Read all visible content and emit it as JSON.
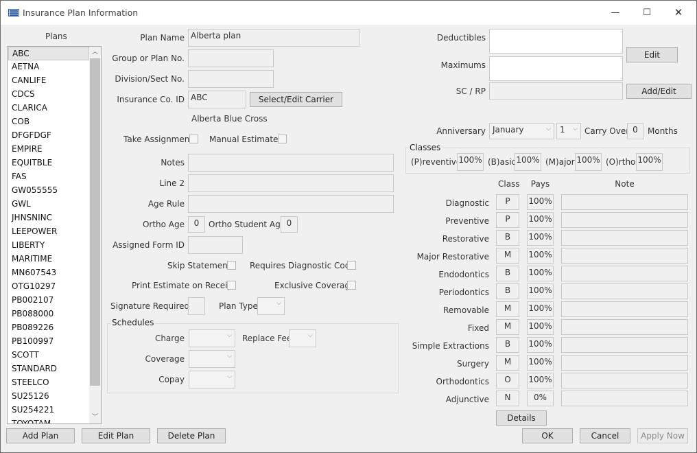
{
  "window": {
    "title": "Insurance Plan Information",
    "minimize": "—",
    "maximize": "☐",
    "close": "✕"
  },
  "plans": {
    "header": "Plans",
    "items": [
      "ABC",
      "AETNA",
      "CANLIFE",
      "CDCS",
      "CLARICA",
      "COB",
      "DFGFDGF",
      "EMPIRE",
      "EQUITBLE",
      "FAS",
      "GW055555",
      "GWL",
      "JHNSNINC",
      "LEEPOWER",
      "LIBERTY",
      "MARITIME",
      "MN607543",
      "OTG10297",
      "PB002107",
      "PB088000",
      "PB089226",
      "PB100997",
      "SCOTT",
      "STANDARD",
      "STEELCO",
      "SU25126",
      "SU254221",
      "TOYOTAM"
    ],
    "selected": "ABC"
  },
  "form": {
    "plan_name_label": "Plan Name",
    "plan_name": "Alberta plan",
    "group_label": "Group or Plan No.",
    "group": "",
    "division_label": "Division/Sect No.",
    "division": "",
    "ins_co_label": "Insurance Co. ID",
    "ins_co": "ABC",
    "select_carrier": "Select/Edit Carrier",
    "carrier_name": "Alberta Blue Cross",
    "take_assignment": "Take Assignment",
    "manual_estimates": "Manual Estimates",
    "notes_label": "Notes",
    "line2_label": "Line 2",
    "age_rule_label": "Age Rule",
    "ortho_age_label": "Ortho Age",
    "ortho_age": "0",
    "ortho_student_age_label": "Ortho Student Age",
    "ortho_student_age": "0",
    "assigned_form_label": "Assigned Form ID",
    "skip_statement": "Skip Statement",
    "requires_diag": "Requires Diagnostic Code",
    "print_estimate": "Print Estimate on Receipt",
    "exclusive_coverage": "Exclusive Coverage",
    "signature_label": "Signature Required",
    "plan_type_label": "Plan Type"
  },
  "schedules": {
    "title": "Schedules",
    "charge_label": "Charge",
    "replace_fee_label": "Replace Fee",
    "coverage_label": "Coverage",
    "copay_label": "Copay"
  },
  "right": {
    "deductibles_label": "Deductibles",
    "maximums_label": "Maximums",
    "edit_button": "Edit",
    "scrp_label": "SC / RP",
    "addedit_button": "Add/Edit",
    "anniversary_label": "Anniversary",
    "anniversary_month": "January",
    "anniversary_day": "1",
    "carry_over_label": "Carry Over",
    "carry_over": "0",
    "months_label": "Months"
  },
  "classes": {
    "title": "Classes",
    "items": [
      {
        "label": "(P)reventive",
        "value": "100%"
      },
      {
        "label": "(B)asic",
        "value": "100%"
      },
      {
        "label": "(M)ajor",
        "value": "100%"
      },
      {
        "label": "(O)rtho",
        "value": "100%"
      }
    ]
  },
  "coverage": {
    "headers": {
      "class": "Class",
      "pays": "Pays",
      "note": "Note"
    },
    "rows": [
      {
        "name": "Diagnostic",
        "cls": "P",
        "pays": "100%"
      },
      {
        "name": "Preventive",
        "cls": "P",
        "pays": "100%"
      },
      {
        "name": "Restorative",
        "cls": "B",
        "pays": "100%"
      },
      {
        "name": "Major Restorative",
        "cls": "M",
        "pays": "100%"
      },
      {
        "name": "Endodontics",
        "cls": "B",
        "pays": "100%"
      },
      {
        "name": "Periodontics",
        "cls": "B",
        "pays": "100%"
      },
      {
        "name": "Removable",
        "cls": "M",
        "pays": "100%"
      },
      {
        "name": "Fixed",
        "cls": "M",
        "pays": "100%"
      },
      {
        "name": "Simple Extractions",
        "cls": "B",
        "pays": "100%"
      },
      {
        "name": "Surgery",
        "cls": "M",
        "pays": "100%"
      },
      {
        "name": "Orthodontics",
        "cls": "O",
        "pays": "100%"
      },
      {
        "name": "Adjunctive",
        "cls": "N",
        "pays": "0%"
      }
    ],
    "details_button": "Details"
  },
  "footer": {
    "add_plan": "Add Plan",
    "edit_plan": "Edit Plan",
    "delete_plan": "Delete Plan",
    "ok": "OK",
    "cancel": "Cancel",
    "apply_now": "Apply Now"
  }
}
